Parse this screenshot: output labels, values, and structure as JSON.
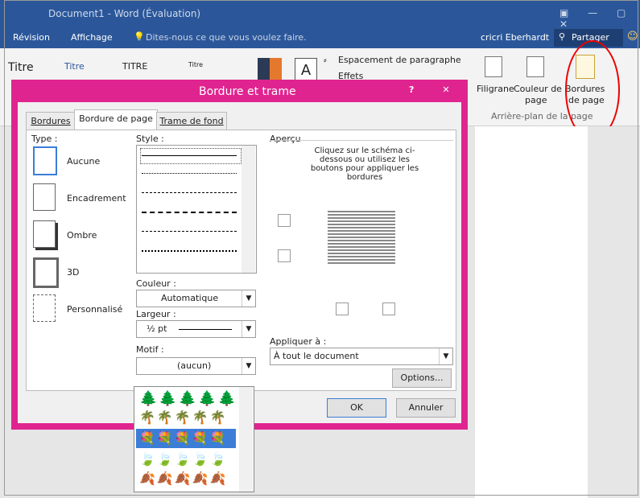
{
  "window": {
    "title": "Document1 - Word (Évaluation)"
  },
  "menu": {
    "revision": "Révision",
    "affichage": "Affichage",
    "tellme": "Dites-nous ce que vous voulez faire.",
    "user": "cricri Eberhardt",
    "share": "Partager"
  },
  "ribbon": {
    "styles": [
      "Titre",
      "Titre",
      "TITRE",
      "Titre"
    ],
    "style_a": "A",
    "espacement": "Espacement de paragraphe",
    "effets": "Effets",
    "filigrane": "Filigrane",
    "couleur_page_1": "Couleur de",
    "couleur_page_2": "page",
    "bordures_page_1": "Bordures",
    "bordures_page_2": "de page",
    "group_label": "Arrière-plan de la page"
  },
  "dialog": {
    "title": "Bordure et trame",
    "help": "?",
    "close": "✕",
    "tabs": [
      "Bordures",
      "Bordure de page",
      "Trame de fond"
    ],
    "type_label": "Type :",
    "types": [
      "Aucune",
      "Encadrement",
      "Ombre",
      "3D",
      "Personnalisé"
    ],
    "style_label": "Style :",
    "couleur_label": "Couleur :",
    "couleur_value": "Automatique",
    "largeur_label": "Largeur :",
    "largeur_value": "½ pt",
    "motif_label": "Motif :",
    "motif_value": "(aucun)",
    "apercu_label": "Aperçu",
    "apercu_instructions": "Cliquez sur le schéma ci-dessous ou utilisez les boutons pour appliquer les bordures",
    "appliquer_label": "Appliquer à :",
    "appliquer_value": "À tout le document",
    "options": "Options...",
    "ok": "OK",
    "annuler": "Annuler"
  },
  "colors": {
    "word_blue": "#2b579a",
    "dialog_pink": "#e0248f",
    "highlight": "#3c7dd8",
    "annotation_red": "#e00000"
  },
  "icons": [
    "window-icons",
    "lightbulb-icon",
    "person-icon",
    "smiley-icon",
    "help-icon",
    "close-icon",
    "tree-art-icon",
    "flower-art-icon",
    "leaf-art-icon"
  ]
}
